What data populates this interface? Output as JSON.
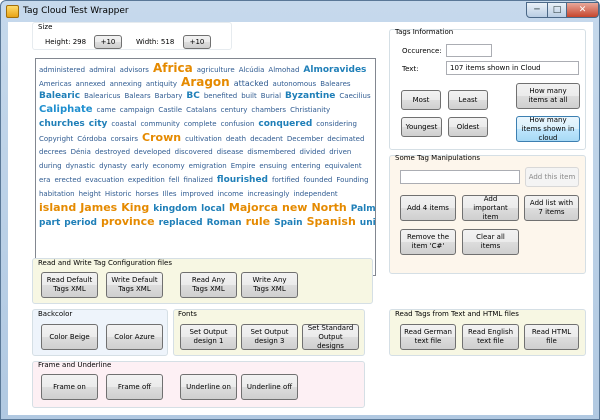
{
  "window": {
    "title": "Tag Cloud Test Wrapper",
    "min_glyph": "─",
    "max_glyph": "□",
    "close_glyph": "✕"
  },
  "size": {
    "group_label": "Size",
    "height_label": "Height: 298",
    "height_button": "+10",
    "width_label": "Width: 518",
    "width_button": "+10"
  },
  "cloud": [
    [
      [
        "administered",
        1
      ],
      [
        "admiral",
        1
      ],
      [
        "advisors",
        1
      ],
      [
        "Africa",
        6
      ],
      [
        "agriculture",
        1
      ],
      [
        "Alcúdia",
        1
      ],
      [
        "Almohad",
        1
      ],
      [
        "Almoravides",
        3
      ]
    ],
    [
      [
        "Americas",
        1
      ],
      [
        "annexed",
        1
      ],
      [
        "annexing",
        1
      ],
      [
        "antiquity",
        1
      ],
      [
        "Aragon",
        6
      ],
      [
        "attacked",
        2
      ],
      [
        "autonomous",
        1
      ],
      [
        "Baleares",
        1
      ]
    ],
    [
      [
        "Balearic",
        3
      ],
      [
        "Balearicus",
        1
      ],
      [
        "Balears",
        1
      ],
      [
        "Barbary",
        1
      ],
      [
        "BC",
        3
      ],
      [
        "benefited",
        1
      ],
      [
        "built",
        1
      ],
      [
        "Burial",
        1
      ],
      [
        "Byzantine",
        3
      ],
      [
        "Caecilius",
        1
      ]
    ],
    [
      [
        "Caliphate",
        4
      ],
      [
        "came",
        1
      ],
      [
        "campaign",
        1
      ],
      [
        "Castile",
        1
      ],
      [
        "Catalans",
        1
      ],
      [
        "century",
        1
      ],
      [
        "chambers",
        1
      ],
      [
        "Christianity",
        1
      ]
    ],
    [
      [
        "churches",
        3
      ],
      [
        "city",
        3
      ],
      [
        "coastal",
        1
      ],
      [
        "community",
        1
      ],
      [
        "complete",
        1
      ],
      [
        "confusion",
        1
      ],
      [
        "conquered",
        3
      ],
      [
        "considering",
        1
      ]
    ],
    [
      [
        "Copyright",
        1
      ],
      [
        "Córdoba",
        1
      ],
      [
        "corsairs",
        1
      ],
      [
        "Crown",
        5
      ],
      [
        "cultivation",
        1
      ],
      [
        "death",
        1
      ],
      [
        "decadent",
        1
      ],
      [
        "December",
        1
      ],
      [
        "decimated",
        1
      ]
    ],
    [
      [
        "decrees",
        1
      ],
      [
        "Dénia",
        1
      ],
      [
        "destroyed",
        1
      ],
      [
        "developed",
        1
      ],
      [
        "discovered",
        1
      ],
      [
        "disease",
        1
      ],
      [
        "dismembered",
        1
      ],
      [
        "divided",
        1
      ],
      [
        "driven",
        1
      ]
    ],
    [
      [
        "during",
        1
      ],
      [
        "dynastic",
        1
      ],
      [
        "dynasty",
        1
      ],
      [
        "early",
        1
      ],
      [
        "economy",
        1
      ],
      [
        "emigration",
        1
      ],
      [
        "Empire",
        1
      ],
      [
        "ensuing",
        1
      ],
      [
        "entering",
        1
      ],
      [
        "equivalent",
        1
      ]
    ],
    [
      [
        "era",
        1
      ],
      [
        "erected",
        1
      ],
      [
        "evacuation",
        1
      ],
      [
        "expedition",
        1
      ],
      [
        "fell",
        1
      ],
      [
        "finalized",
        1
      ],
      [
        "flourished",
        3
      ],
      [
        "fortified",
        1
      ],
      [
        "founded",
        1
      ],
      [
        "Founding",
        1
      ]
    ],
    [
      [
        "habitation",
        1
      ],
      [
        "height",
        1
      ],
      [
        "Historic",
        1
      ],
      [
        "horses",
        1
      ],
      [
        "Illes",
        1
      ],
      [
        "improved",
        1
      ],
      [
        "income",
        1
      ],
      [
        "increasingly",
        1
      ],
      [
        "independent",
        1
      ]
    ],
    [
      [
        "island",
        5
      ],
      [
        "James",
        5
      ],
      [
        "King",
        5
      ],
      [
        "kingdom",
        3
      ],
      [
        "local",
        3
      ],
      [
        "Majorca",
        5
      ],
      [
        "new",
        5
      ],
      [
        "North",
        5
      ],
      [
        "Palma",
        3
      ]
    ],
    [
      [
        "part",
        3
      ],
      [
        "period",
        3
      ],
      [
        "province",
        5
      ],
      [
        "replaced",
        3
      ],
      [
        "Roman",
        3
      ],
      [
        "rule",
        5
      ],
      [
        "Spain",
        3
      ],
      [
        "Spanish",
        5
      ],
      [
        "union",
        3
      ]
    ]
  ],
  "tags_info": {
    "group_label": "Tags Information",
    "occurrence_label": "Occurence:",
    "occurrence_value": "",
    "text_label": "Text:",
    "text_value": "107 items shown in Cloud",
    "most_button": "Most",
    "least_button": "Least",
    "how_many_all_button": "How many items at all",
    "youngest_button": "Youngest",
    "oldest_button": "Oldest",
    "how_many_shown_button": "How many items shown in cloud"
  },
  "manipulations": {
    "group_label": "Some Tag Manipulations",
    "input_value": "",
    "add_item_button": "Add this item",
    "add4_button": "Add 4 items",
    "add_important_button": "Add important item",
    "add_list_button": "Add list with 7 items",
    "remove_button": "Remove the item 'C#'",
    "clear_button": "Clear all items"
  },
  "config_files": {
    "group_label": "Read and Write Tag Configuration files",
    "read_default": "Read Default Tags XML",
    "write_default": "Write Default Tags XML",
    "read_any": "Read Any Tags XML",
    "write_any": "Write Any Tags XML"
  },
  "backcolor": {
    "group_label": "Backcolor",
    "beige": "Color Beige",
    "azure": "Color Azure"
  },
  "fonts": {
    "group_label": "Fonts",
    "output1": "Set Output design 1",
    "output3": "Set Output design 3",
    "standard": "Set Standard Output designs"
  },
  "read_tags": {
    "group_label": "Read Tags from Text and HTML files",
    "german": "Read German text file",
    "english": "Read English text file",
    "html": "Read HTML file"
  },
  "frame": {
    "group_label": "Frame and Underline",
    "frame_on": "Frame on",
    "frame_off": "Frame off",
    "underline_on": "Underline on",
    "underline_off": "Underline off"
  },
  "colors": {
    "tag_small": "#2f5b91",
    "tag_medium": "#1f8fcf",
    "tag_large": "#e58a00",
    "config_bg": "#f7f7e3",
    "backcolor_bg": "#eef4fb",
    "fonts_bg": "#f7f7e3",
    "frame_bg": "#fdf0f4",
    "read_tags_bg": "#f7f7e3",
    "manipulations_bg": "#fdf6ec"
  }
}
